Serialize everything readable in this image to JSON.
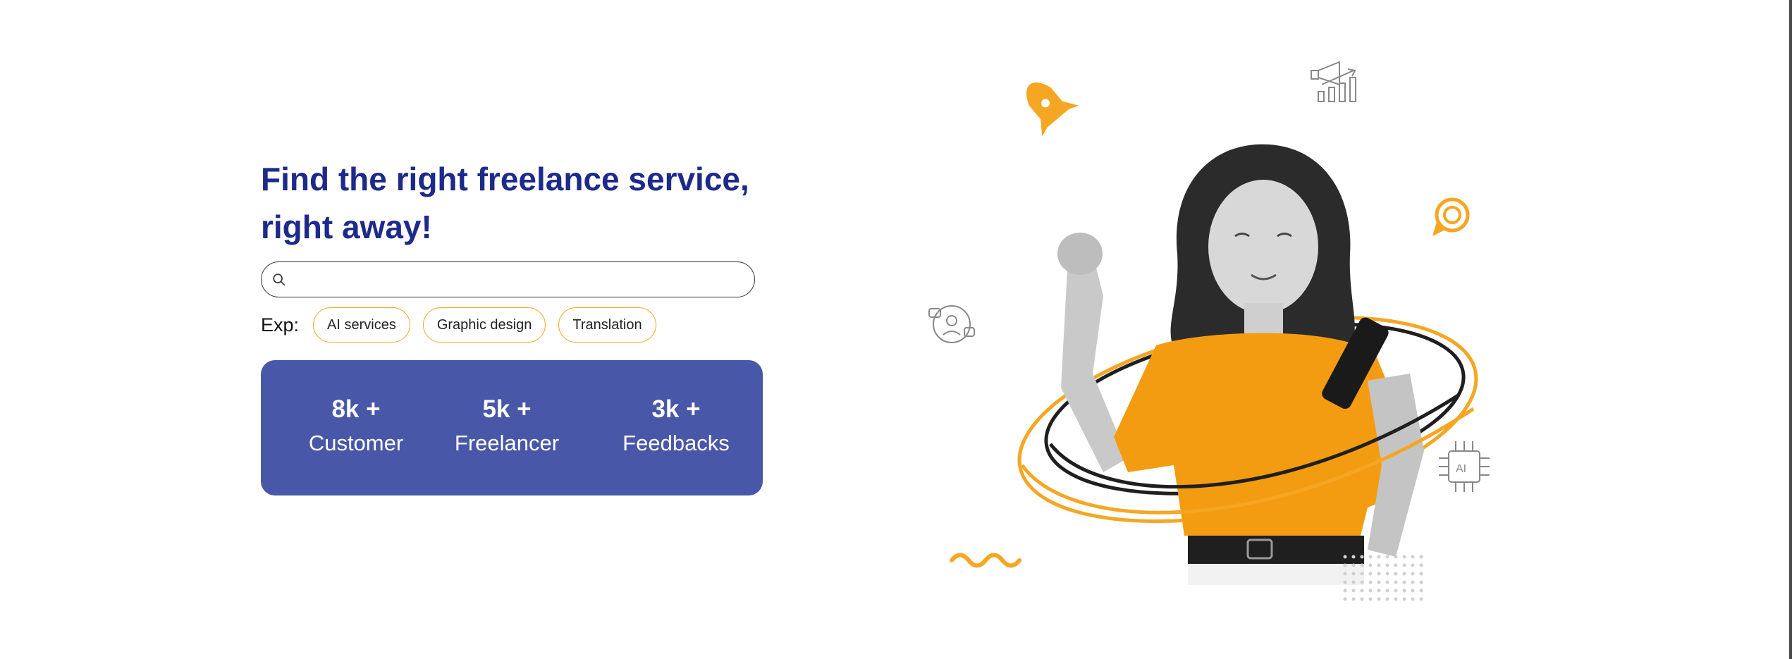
{
  "hero": {
    "title_line1": "Find the right freelance service,",
    "title_line2": "right away!"
  },
  "search": {
    "value": "",
    "placeholder": ""
  },
  "examples": {
    "label": "Exp:",
    "chips": [
      "AI services",
      "Graphic design",
      "Translation"
    ]
  },
  "stats": [
    {
      "value": "8k +",
      "label": "Customer"
    },
    {
      "value": "5k +",
      "label": "Freelancer"
    },
    {
      "value": "3k +",
      "label": "Feedbacks"
    }
  ],
  "colors": {
    "title": "#1d2a8a",
    "card": "#4957a8",
    "accent": "#f5a623",
    "shirt": "#f39c12"
  },
  "illustration": {
    "icons": [
      "rocket-icon",
      "megaphone-chart-icon",
      "lightbulb-target-icon",
      "user-chat-icon",
      "ai-chip-icon",
      "wave-decoration",
      "dot-grid-decoration"
    ]
  }
}
